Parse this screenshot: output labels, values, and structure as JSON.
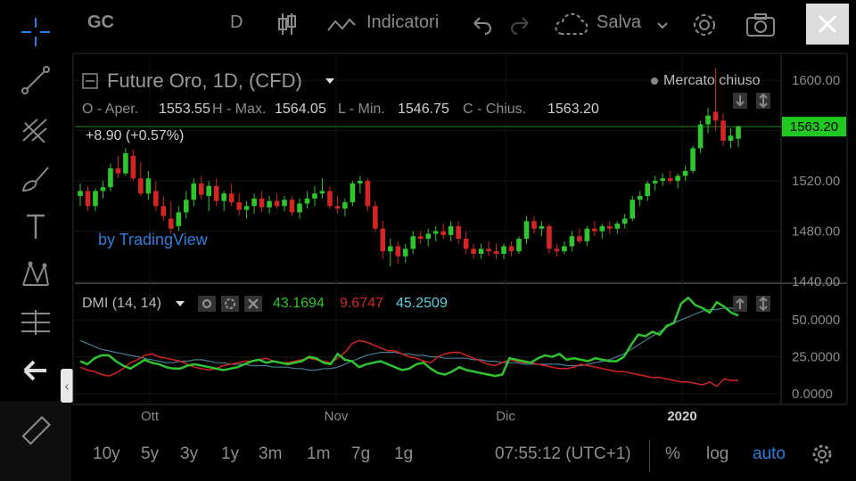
{
  "toolbar": {
    "symbol": "GC",
    "interval": "D",
    "indicators_label": "Indicatori",
    "save_label": "Salva"
  },
  "legend": {
    "title": "Future Oro, 1D, (CFD)",
    "market_status": "Mercato chiuso",
    "open_label": "O - Aper.",
    "open_value": "1553.55",
    "high_label": "H - Max.",
    "high_value": "1564.05",
    "low_label": "L - Min.",
    "low_value": "1546.75",
    "close_label": "C - Chius.",
    "close_value": "1563.20",
    "change": "+8.90 (+0.57%)",
    "watermark": "by TradingView"
  },
  "dmi_legend": {
    "title": "DMI (14, 14)",
    "plus_di": "43.1694",
    "minus_di": "9.6747",
    "adx": "45.2509"
  },
  "bottom": {
    "ranges": [
      "10y",
      "5y",
      "3y",
      "1y",
      "3m",
      "1m",
      "7g",
      "1g"
    ],
    "time": "07:55:12 (UTC+1)",
    "percent": "%",
    "log": "log",
    "auto": "auto"
  },
  "colors": {
    "up": "#2fc52f",
    "down": "#d52424",
    "adx": "#4a7f96",
    "accent": "#2b7fdc",
    "last_price": "#22c822"
  },
  "chart_data": [
    {
      "type": "candlestick",
      "title": "Future Oro, 1D, (CFD)",
      "ylim": [
        1440,
        1620
      ],
      "y_ticks": [
        "1600.00",
        "1560.00",
        "1520.00",
        "1480.00",
        "1440.00"
      ],
      "last_price": "1563.20",
      "x_ticks": [
        "Ott",
        "Nov",
        "Dic",
        "2020"
      ],
      "series": [
        {
          "values_ohlc": [
            [
              1508,
              1518,
              1500,
              1512
            ],
            [
              1512,
              1516,
              1496,
              1500
            ],
            [
              1500,
              1514,
              1496,
              1512
            ],
            [
              1512,
              1520,
              1506,
              1515
            ],
            [
              1515,
              1534,
              1512,
              1530
            ],
            [
              1530,
              1540,
              1522,
              1526
            ],
            [
              1526,
              1546,
              1524,
              1542
            ],
            [
              1540,
              1545,
              1520,
              1522
            ],
            [
              1522,
              1535,
              1508,
              1510
            ],
            [
              1510,
              1528,
              1505,
              1522
            ],
            [
              1512,
              1520,
              1496,
              1500
            ],
            [
              1500,
              1508,
              1488,
              1492
            ],
            [
              1490,
              1504,
              1478,
              1482
            ],
            [
              1484,
              1500,
              1480,
              1495
            ],
            [
              1495,
              1512,
              1490,
              1505
            ],
            [
              1505,
              1522,
              1500,
              1518
            ],
            [
              1518,
              1524,
              1505,
              1509
            ],
            [
              1508,
              1520,
              1496,
              1516
            ],
            [
              1516,
              1522,
              1500,
              1504
            ],
            [
              1504,
              1512,
              1496,
              1510
            ],
            [
              1510,
              1518,
              1500,
              1503
            ],
            [
              1503,
              1510,
              1492,
              1497
            ],
            [
              1497,
              1504,
              1490,
              1500
            ],
            [
              1500,
              1510,
              1494,
              1506
            ],
            [
              1506,
              1512,
              1495,
              1499
            ],
            [
              1499,
              1508,
              1494,
              1504
            ],
            [
              1504,
              1510,
              1498,
              1500
            ],
            [
              1500,
              1508,
              1496,
              1505
            ],
            [
              1505,
              1508,
              1492,
              1495
            ],
            [
              1495,
              1506,
              1490,
              1502
            ],
            [
              1502,
              1512,
              1498,
              1506
            ],
            [
              1506,
              1516,
              1500,
              1510
            ],
            [
              1510,
              1522,
              1506,
              1512
            ],
            [
              1512,
              1516,
              1498,
              1500
            ],
            [
              1500,
              1508,
              1494,
              1498
            ],
            [
              1498,
              1506,
              1492,
              1503
            ],
            [
              1503,
              1520,
              1500,
              1518
            ],
            [
              1518,
              1524,
              1510,
              1520
            ],
            [
              1520,
              1522,
              1496,
              1500
            ],
            [
              1500,
              1504,
              1480,
              1482
            ],
            [
              1482,
              1488,
              1458,
              1464
            ],
            [
              1464,
              1474,
              1452,
              1468
            ],
            [
              1468,
              1472,
              1454,
              1460
            ],
            [
              1460,
              1470,
              1455,
              1466
            ],
            [
              1466,
              1480,
              1462,
              1476
            ],
            [
              1476,
              1480,
              1470,
              1474
            ],
            [
              1474,
              1482,
              1468,
              1478
            ],
            [
              1478,
              1484,
              1472,
              1480
            ],
            [
              1480,
              1486,
              1474,
              1477
            ],
            [
              1477,
              1488,
              1472,
              1484
            ],
            [
              1484,
              1488,
              1470,
              1474
            ],
            [
              1474,
              1480,
              1462,
              1466
            ],
            [
              1466,
              1470,
              1458,
              1462
            ],
            [
              1462,
              1470,
              1458,
              1466
            ],
            [
              1466,
              1472,
              1460,
              1464
            ],
            [
              1464,
              1470,
              1458,
              1462
            ],
            [
              1462,
              1470,
              1458,
              1468
            ],
            [
              1468,
              1472,
              1460,
              1464
            ],
            [
              1464,
              1476,
              1462,
              1474
            ],
            [
              1474,
              1492,
              1470,
              1488
            ],
            [
              1488,
              1492,
              1478,
              1482
            ],
            [
              1482,
              1488,
              1476,
              1484
            ],
            [
              1484,
              1486,
              1462,
              1466
            ],
            [
              1466,
              1470,
              1460,
              1464
            ],
            [
              1464,
              1472,
              1462,
              1468
            ],
            [
              1468,
              1480,
              1464,
              1476
            ],
            [
              1476,
              1482,
              1470,
              1472
            ],
            [
              1472,
              1484,
              1468,
              1482
            ],
            [
              1482,
              1488,
              1476,
              1480
            ],
            [
              1480,
              1486,
              1474,
              1484
            ],
            [
              1484,
              1488,
              1478,
              1482
            ],
            [
              1482,
              1488,
              1478,
              1486
            ],
            [
              1486,
              1494,
              1482,
              1490
            ],
            [
              1490,
              1508,
              1488,
              1505
            ],
            [
              1505,
              1512,
              1500,
              1508
            ],
            [
              1508,
              1520,
              1504,
              1518
            ],
            [
              1518,
              1524,
              1512,
              1520
            ],
            [
              1520,
              1526,
              1516,
              1522
            ],
            [
              1522,
              1528,
              1518,
              1520
            ],
            [
              1520,
              1526,
              1514,
              1524
            ],
            [
              1524,
              1532,
              1520,
              1528
            ],
            [
              1528,
              1548,
              1526,
              1546
            ],
            [
              1546,
              1568,
              1542,
              1565
            ],
            [
              1565,
              1578,
              1558,
              1572
            ],
            [
              1575,
              1610,
              1560,
              1568
            ],
            [
              1568,
              1574,
              1548,
              1552
            ],
            [
              1552,
              1562,
              1546,
              1556
            ],
            [
              1553.55,
              1564.05,
              1546.75,
              1563.2
            ]
          ]
        }
      ]
    },
    {
      "type": "line",
      "title": "DMI (14, 14)",
      "ylim": [
        0,
        70
      ],
      "y_ticks": [
        "50.0000",
        "25.0000",
        "0.0000"
      ],
      "series": [
        {
          "name": "+DI",
          "values": [
            22,
            20,
            24,
            26,
            26,
            22,
            19,
            17,
            20,
            23,
            21,
            20,
            18,
            17,
            17,
            19,
            20,
            19,
            18,
            17,
            16,
            17,
            18,
            20,
            22,
            23,
            21,
            22,
            21,
            20,
            21,
            22,
            25,
            24,
            21,
            20,
            27,
            23,
            22,
            18,
            20,
            21,
            22,
            20,
            18,
            16,
            17,
            20,
            21,
            17,
            14,
            13,
            15,
            18,
            16,
            15,
            14,
            13,
            12,
            13,
            24,
            23,
            22,
            21,
            24,
            26,
            25,
            27,
            23,
            24,
            23,
            22,
            24,
            23,
            22,
            22,
            25,
            33,
            40,
            39,
            42,
            40,
            46,
            48,
            61,
            65,
            60,
            58,
            55,
            62,
            59,
            55,
            53
          ]
        },
        {
          "name": "-DI",
          "values": [
            18,
            16,
            15,
            13,
            12,
            14,
            17,
            21,
            23,
            26,
            27,
            25,
            24,
            23,
            22,
            20,
            18,
            17,
            16,
            17,
            19,
            20,
            21,
            22,
            22,
            23,
            24,
            22,
            21,
            21,
            22,
            23,
            24,
            23,
            22,
            21,
            24,
            28,
            34,
            36,
            35,
            33,
            31,
            29,
            29,
            27,
            25,
            24,
            22,
            21,
            25,
            27,
            28,
            28,
            26,
            24,
            22,
            20,
            19,
            21,
            23,
            22,
            21,
            21,
            20,
            19,
            18,
            17,
            17,
            18,
            20,
            19,
            18,
            17,
            16,
            15,
            15,
            14,
            13,
            12,
            11,
            11,
            10,
            9,
            8,
            8,
            7,
            6,
            8,
            5,
            10,
            9,
            9
          ]
        },
        {
          "name": "ADX",
          "values": [
            36,
            34,
            32,
            30,
            29,
            28,
            27,
            26,
            25,
            24,
            23,
            22,
            21,
            21,
            22,
            22,
            23,
            23,
            22,
            21,
            21,
            20,
            20,
            20,
            19,
            19,
            19,
            18,
            18,
            18,
            17,
            17,
            16,
            16,
            17,
            17,
            18,
            20,
            22,
            24,
            26,
            27,
            28,
            28,
            28,
            27,
            27,
            26,
            26,
            25,
            25,
            24,
            24,
            24,
            24,
            23,
            23,
            22,
            22,
            21,
            21,
            21,
            20,
            20,
            20,
            20,
            20,
            20,
            19,
            19,
            19,
            20,
            21,
            22,
            23,
            25,
            27,
            30,
            33,
            36,
            39,
            42,
            45,
            48,
            50,
            52,
            54,
            56,
            57,
            57,
            58,
            58,
            57
          ]
        }
      ]
    }
  ]
}
